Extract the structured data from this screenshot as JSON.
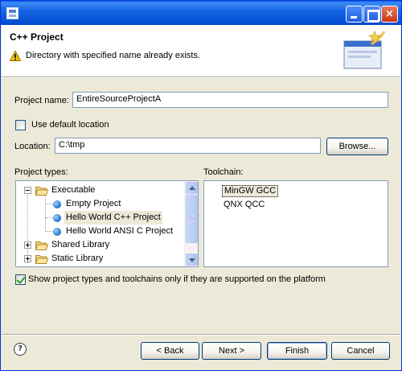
{
  "window": {
    "title_bar": {
      "app_icon": "eclipse-dialog-icon",
      "buttons": {
        "minimize": "minimize-icon",
        "maximize": "maximize-icon",
        "close_glyph": "×"
      }
    }
  },
  "header": {
    "title": "C++ Project",
    "message": "Directory with specified name already exists.",
    "message_icon": "warning-icon",
    "banner_icon": "wizard-banner-icon"
  },
  "form": {
    "project_name_label": "Project name:",
    "project_name_value": "EntireSourceProjectA",
    "use_default_label": "Use default location",
    "use_default_checked": false,
    "location_label": "Location:",
    "location_value": "C:\\tmp",
    "browse_button": "Browse..."
  },
  "project_types": {
    "label": "Project types:",
    "items": [
      {
        "label": "Executable",
        "kind": "folder",
        "expanded": true,
        "level": 0
      },
      {
        "label": "Empty Project",
        "kind": "leaf",
        "level": 1
      },
      {
        "label": "Hello World C++ Project",
        "kind": "leaf",
        "level": 1,
        "selected": true
      },
      {
        "label": "Hello World ANSI C Project",
        "kind": "leaf",
        "level": 1
      },
      {
        "label": "Shared Library",
        "kind": "folder",
        "expanded": false,
        "level": 0
      },
      {
        "label": "Static Library",
        "kind": "folder",
        "expanded": false,
        "level": 0
      }
    ]
  },
  "toolchain": {
    "label": "Toolchain:",
    "items": [
      {
        "label": "MinGW GCC",
        "selected": true
      },
      {
        "label": "QNX QCC",
        "selected": false
      }
    ]
  },
  "filter": {
    "label": "Show project types and toolchains only if they are supported on the platform",
    "checked": true
  },
  "footer": {
    "help_glyph": "?",
    "back_button": "< Back",
    "next_button": "Next >",
    "finish_button": "Finish",
    "cancel_button": "Cancel"
  },
  "colors": {
    "titlebar_blue": "#0a5fe4",
    "dialog_bg": "#ece9d8",
    "field_border": "#7f9db9",
    "warning_yellow": "#f7c600"
  }
}
